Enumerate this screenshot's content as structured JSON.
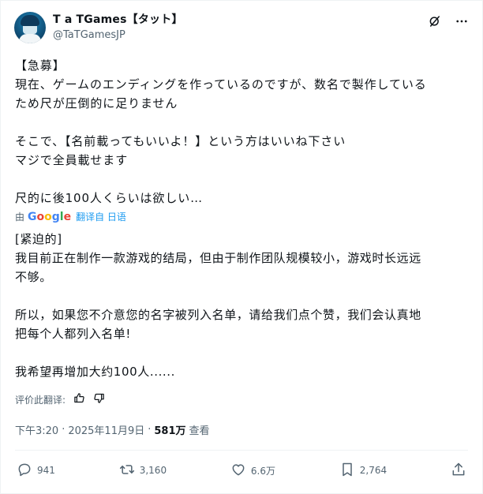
{
  "author": {
    "display_name": "T a TGames【タット】",
    "handle": "@TaTGamesJP"
  },
  "icons": {
    "grok": "grok-icon",
    "more": "more-icon",
    "reply": "reply-icon",
    "repost": "repost-icon",
    "like": "like-icon",
    "bookmark": "bookmark-icon",
    "share": "share-icon",
    "thumb_up": "thumb-up-icon",
    "thumb_down": "thumb-down-icon"
  },
  "tweet": {
    "lines": [
      "【急募】",
      "現在、ゲームのエンディングを作っているのですが、数名で製作している",
      "ため尺が圧倒的に足りません",
      "そこで、【名前載ってもいいよ！】という方はいいね下さい",
      "マジで全員載せます",
      "尺的に後100人くらいは欲しい…"
    ]
  },
  "translation": {
    "by": "由",
    "google": "Google",
    "link": "翻译自 日语",
    "lines": [
      "[紧迫的]",
      "我目前正在制作一款游戏的结局，但由于制作团队规模较小，游戏时长远远",
      "不够。",
      "所以，如果您不介意您的名字被列入名单，请给我们点个赞，我们会认真地",
      "把每个人都列入名单!",
      "我希望再增加大约100人......"
    ],
    "rate_label": "评价此翻译:"
  },
  "meta": {
    "time": "下午3:20",
    "date": "2025年11月9日",
    "separator": "·",
    "views": "581万",
    "views_label": "查看"
  },
  "actions": {
    "replies": "941",
    "reposts": "3,160",
    "likes": "6.6万",
    "bookmarks": "2,764"
  },
  "colors": {
    "text": "#0f1419",
    "secondary": "#536471",
    "link": "#1d9bf0",
    "divider": "#eff3f4"
  }
}
